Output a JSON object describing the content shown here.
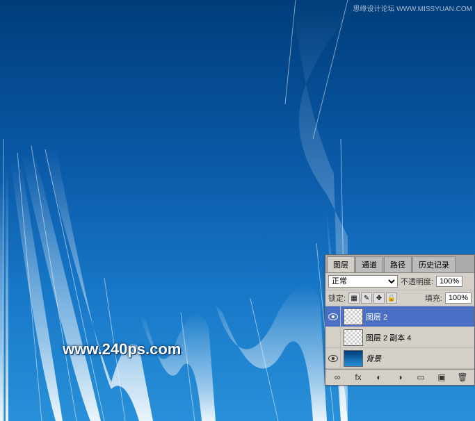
{
  "watermark_top": "思缘设计论坛 WWW.MISSYUAN.COM",
  "watermark_url": "www.240ps.com",
  "panel": {
    "tabs": [
      "图层",
      "通道",
      "路径",
      "历史记录"
    ],
    "blend_mode": "正常",
    "opacity_label": "不透明度:",
    "opacity_value": "100%",
    "lock_label": "锁定:",
    "fill_label": "填充:",
    "fill_value": "100%"
  },
  "layers": [
    {
      "name": "图层 2",
      "visible": true,
      "thumb": "checker",
      "selected": true,
      "italic": false
    },
    {
      "name": "图层 2 副本 4",
      "visible": false,
      "thumb": "checker",
      "selected": false,
      "italic": false
    },
    {
      "name": "背景",
      "visible": true,
      "thumb": "blue",
      "selected": false,
      "italic": true
    }
  ]
}
